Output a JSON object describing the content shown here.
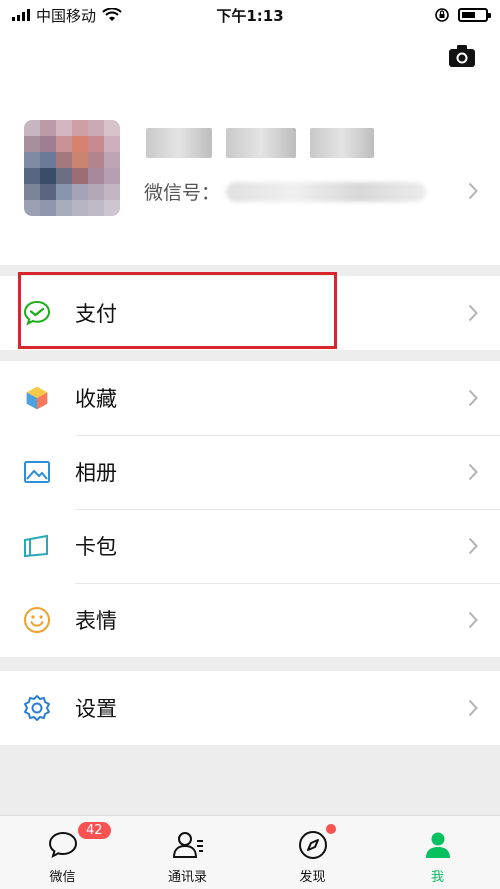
{
  "status_bar": {
    "carrier": "中国移动",
    "time": "下午1:13"
  },
  "profile": {
    "wechat_id_label": "微信号："
  },
  "menu_groups": [
    [
      {
        "label": "支付",
        "icon": "wechat-pay-icon"
      }
    ],
    [
      {
        "label": "收藏",
        "icon": "favorites-cube-icon"
      },
      {
        "label": "相册",
        "icon": "album-image-icon"
      },
      {
        "label": "卡包",
        "icon": "card-wallet-icon"
      },
      {
        "label": "表情",
        "icon": "smiley-icon"
      }
    ],
    [
      {
        "label": "设置",
        "icon": "settings-gear-icon"
      }
    ]
  ],
  "tab_bar": {
    "tabs": [
      {
        "label": "微信",
        "icon": "chat-bubble-icon",
        "badge": "42"
      },
      {
        "label": "通讯录",
        "icon": "contacts-icon"
      },
      {
        "label": "发现",
        "icon": "discover-compass-icon"
      },
      {
        "label": "我",
        "icon": "me-person-icon"
      }
    ]
  },
  "colors": {
    "accent_green": "#07c160",
    "badge_red": "#fa5151",
    "highlight_red": "#d7262e"
  }
}
